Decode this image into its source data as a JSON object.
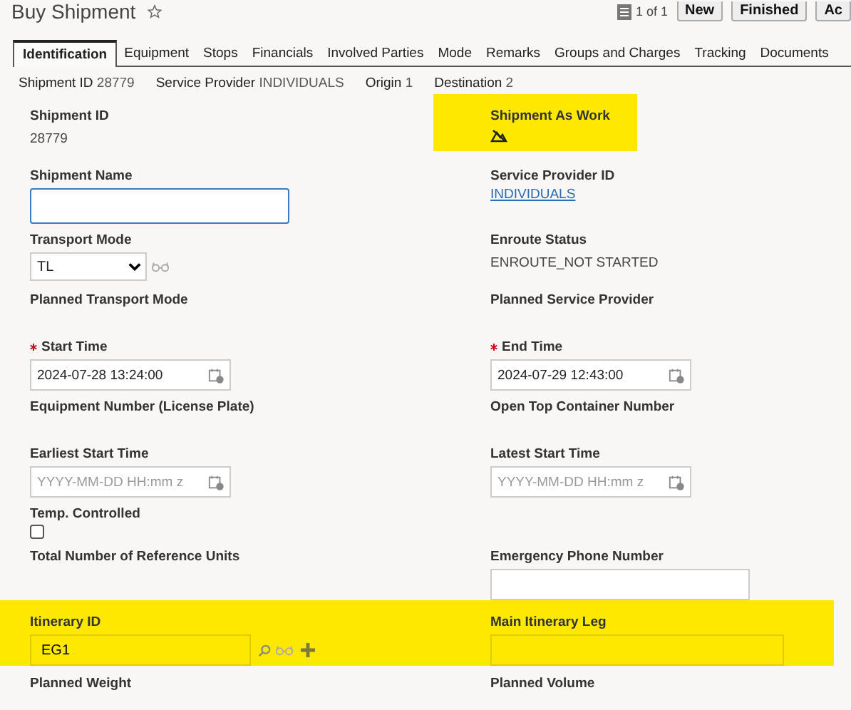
{
  "header": {
    "title": "Buy Shipment",
    "favorite": false,
    "pager": "1 of 1",
    "buttons": [
      "New",
      "Finished",
      "Ac"
    ]
  },
  "tabs": [
    {
      "label": "Identification",
      "selected": true
    },
    {
      "label": "Equipment",
      "selected": false
    },
    {
      "label": "Stops",
      "selected": false
    },
    {
      "label": "Financials",
      "selected": false
    },
    {
      "label": "Involved Parties",
      "selected": false
    },
    {
      "label": "Mode",
      "selected": false
    },
    {
      "label": "Remarks",
      "selected": false
    },
    {
      "label": "Groups and Charges",
      "selected": false
    },
    {
      "label": "Tracking",
      "selected": false
    },
    {
      "label": "Documents",
      "selected": false
    }
  ],
  "summary": [
    {
      "label": "Shipment ID",
      "value": "28779"
    },
    {
      "label": "Service Provider",
      "value": "INDIVIDUALS"
    },
    {
      "label": "Origin",
      "value": "1"
    },
    {
      "label": "Destination",
      "value": "2"
    }
  ],
  "rows": [
    {
      "highlighted": false,
      "left": {
        "label": "Shipment ID",
        "kind": "text",
        "value": "28779",
        "highlighted": false
      },
      "right": {
        "label": "Shipment As Work",
        "kind": "icon",
        "highlighted": true
      }
    },
    {
      "highlighted": false,
      "left": {
        "label": "Shipment Name",
        "kind": "input",
        "focused": true,
        "highlighted": false
      },
      "right": {
        "label": "Service Provider ID",
        "kind": "link",
        "value": "INDIVIDUALS",
        "highlighted": false
      }
    },
    {
      "highlighted": false,
      "left": {
        "label": "Transport Mode",
        "kind": "select",
        "value": "TL",
        "highlighted": false
      },
      "right": {
        "label": "Enroute Status",
        "kind": "text",
        "value": "ENROUTE_NOT STARTED",
        "highlighted": false
      }
    },
    {
      "highlighted": false,
      "left": {
        "label": "Planned Transport Mode",
        "kind": "empty",
        "highlighted": false
      },
      "right": {
        "label": "Planned Service Provider",
        "kind": "empty",
        "highlighted": false
      }
    },
    {
      "highlighted": false,
      "left": {
        "label": "Start Time",
        "kind": "date",
        "required": true,
        "value": "2024-07-28 13:24:00",
        "highlighted": false
      },
      "right": {
        "label": "End Time",
        "kind": "date",
        "required": true,
        "value": "2024-07-29 12:43:00",
        "highlighted": false
      }
    },
    {
      "highlighted": false,
      "left": {
        "label": "Equipment Number (License Plate)",
        "kind": "empty",
        "highlighted": false
      },
      "right": {
        "label": "Open Top Container Number",
        "kind": "empty",
        "highlighted": false
      }
    },
    {
      "highlighted": false,
      "left": {
        "label": "Earliest Start Time",
        "kind": "date",
        "placeholder": "YYYY-MM-DD HH:mm z",
        "highlighted": false
      },
      "right": {
        "label": "Latest Start Time",
        "kind": "date",
        "placeholder": "YYYY-MM-DD HH:mm z",
        "highlighted": false
      }
    },
    {
      "highlighted": false,
      "left": {
        "label": "Temp. Controlled",
        "kind": "checkbox",
        "checked": false,
        "highlighted": false
      }
    },
    {
      "highlighted": false,
      "left": {
        "label": "Total Number of Reference Units",
        "kind": "empty",
        "highlighted": false
      },
      "right": {
        "label": "Emergency Phone Number",
        "kind": "input",
        "focused": false,
        "highlighted": false
      }
    },
    {
      "highlighted": true,
      "left": {
        "label": "Itinerary ID",
        "kind": "lookup",
        "value": "EG1",
        "highlighted": false
      },
      "right": {
        "label": "Main Itinerary Leg",
        "kind": "wide-input",
        "highlighted": false
      }
    },
    {
      "highlighted": false,
      "left": {
        "label": "Planned Weight",
        "kind": "empty",
        "highlighted": false
      },
      "right": {
        "label": "Planned Volume",
        "kind": "empty",
        "highlighted": false
      }
    }
  ]
}
